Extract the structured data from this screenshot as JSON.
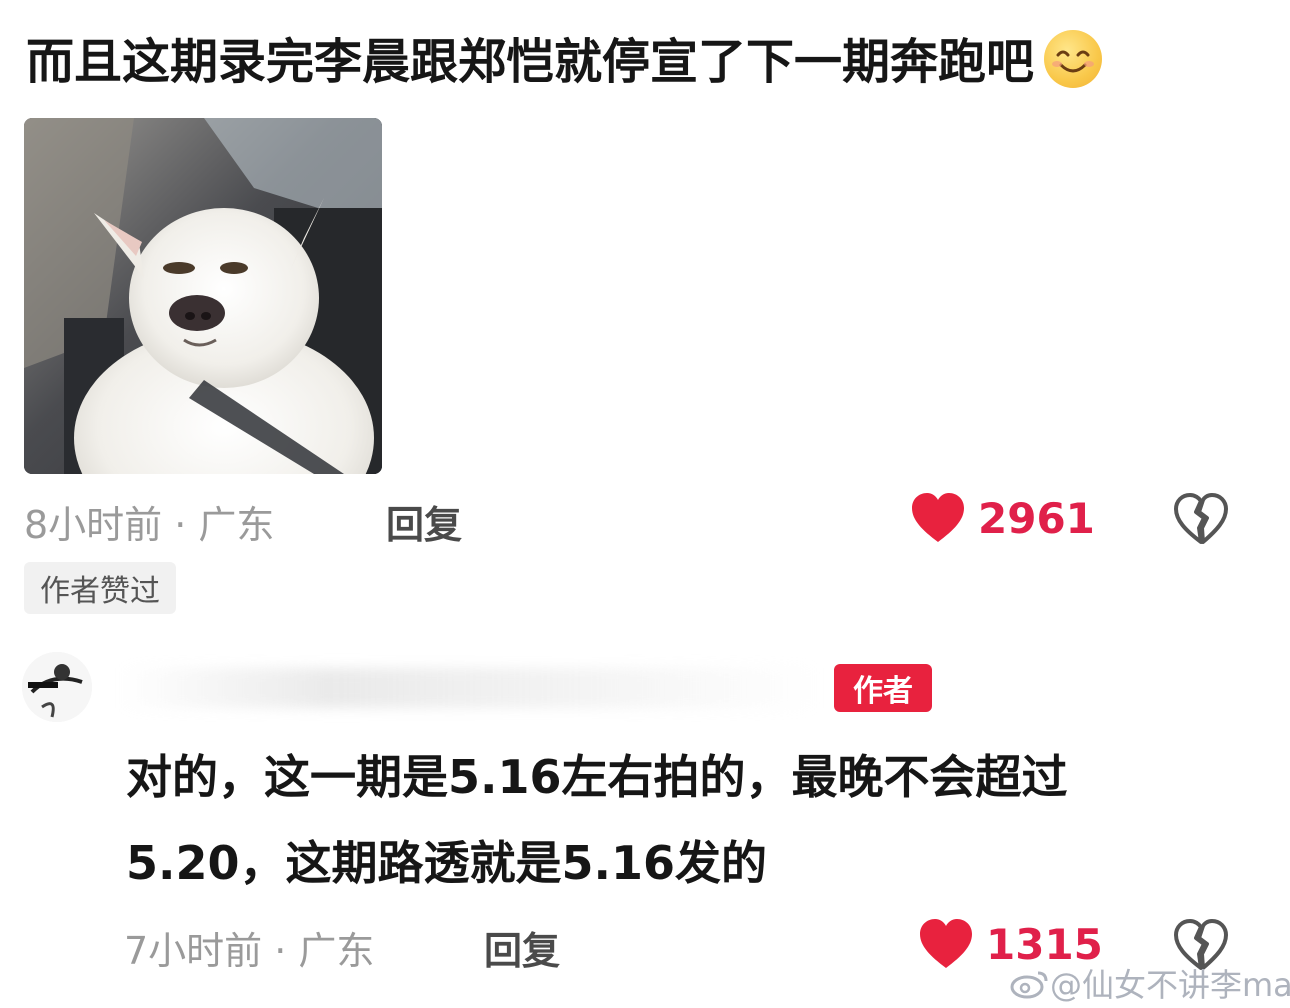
{
  "comment": {
    "text": "而且这期录完李晨跟郑恺就停宣了下一期奔跑吧",
    "emoji": "smiling-face-emoji",
    "time": "8小时前 · 广东",
    "reply_label": "回复",
    "likes": "2961",
    "liked_badge": "作者赞过"
  },
  "reply": {
    "author_badge": "作者",
    "text": "对的，这一期是5.16左右拍的，最晚不会超过5.20，这期路透就是5.16发的",
    "time": "7小时前 · 广东",
    "reply_label": "回复",
    "likes": "1315"
  },
  "watermark": {
    "text": "@仙女不讲李mao"
  },
  "colors": {
    "heart": "#e8223e",
    "like_count": "#e0204a",
    "meta": "#9a9a9a",
    "author_badge": "#e8223e"
  }
}
